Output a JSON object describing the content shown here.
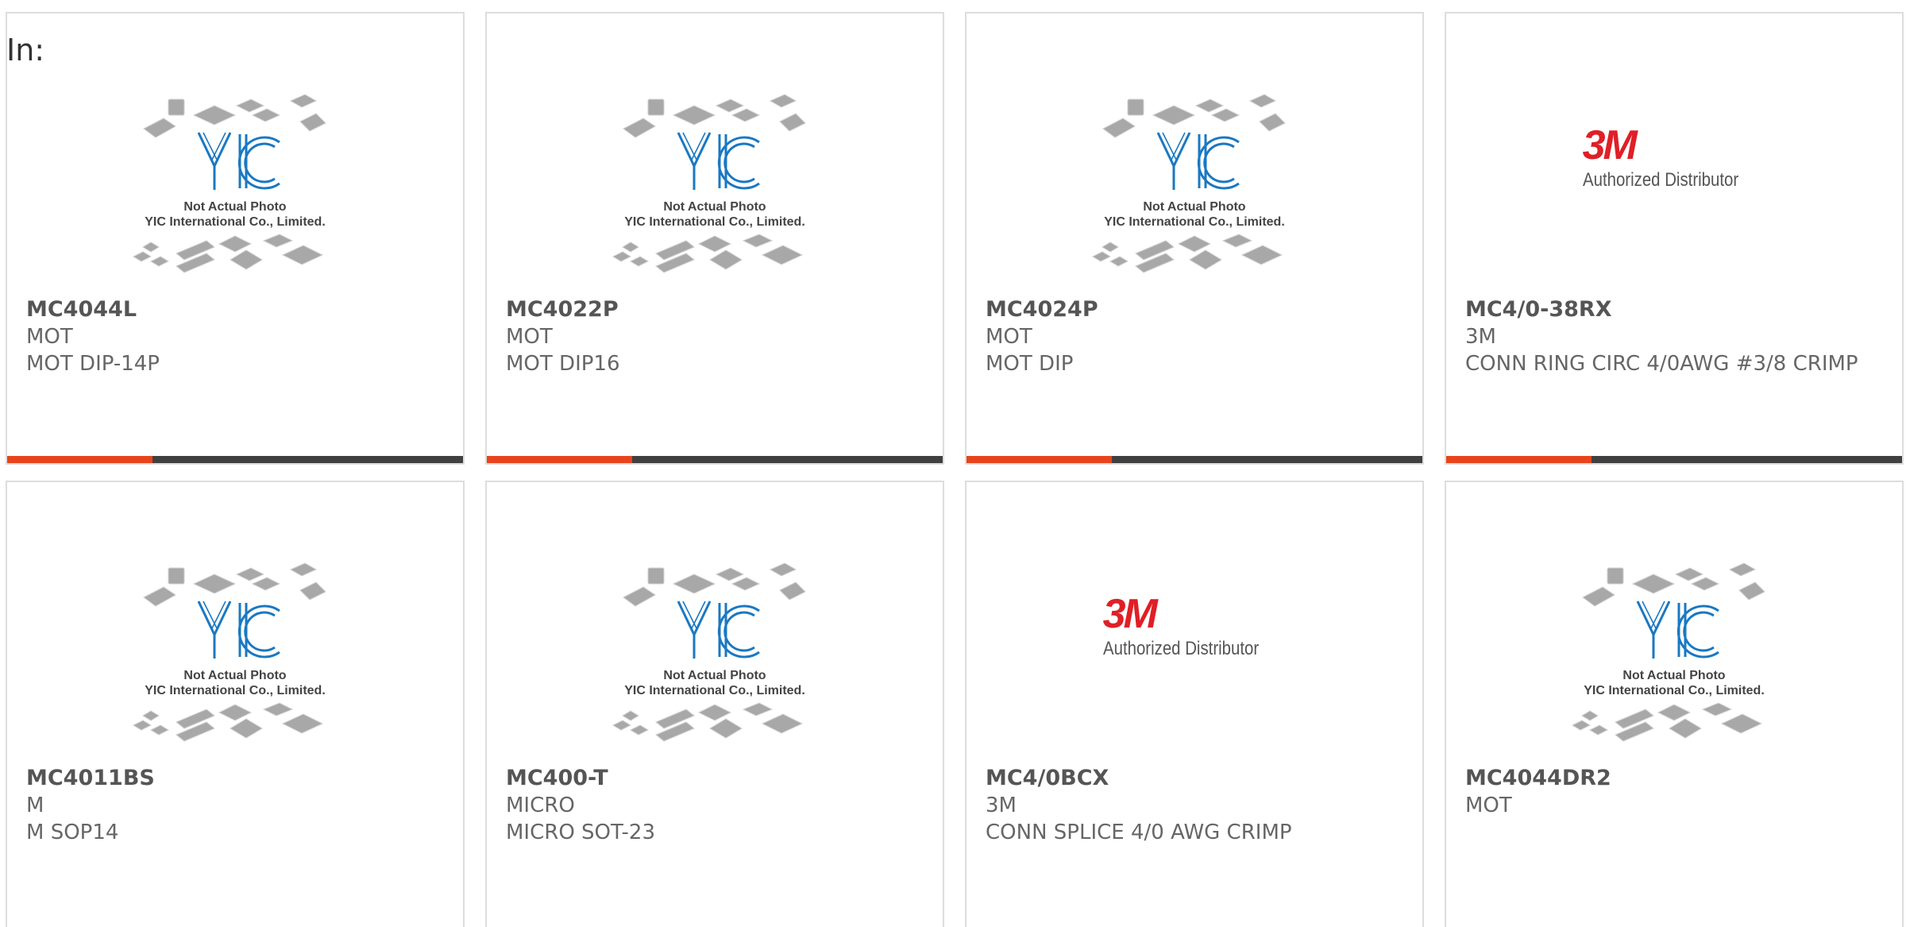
{
  "page": {
    "in_label": "In:"
  },
  "placeholder_image": {
    "line1": "Not Actual Photo",
    "line2": "YIC International Co., Limited."
  },
  "brand_3m": {
    "logo": "3M",
    "tagline": "Authorized Distributor"
  },
  "colors": {
    "accent": "#e8441b",
    "bar_dark": "#404040",
    "logo_blue": "#1a78c2",
    "logo_red": "#e01f26"
  },
  "products": [
    {
      "part": "MC4044L",
      "maker": "MOT",
      "desc": "MOT DIP-14P",
      "image": "yic-placeholder"
    },
    {
      "part": "MC4022P",
      "maker": "MOT",
      "desc": "MOT DIP16",
      "image": "yic-placeholder"
    },
    {
      "part": "MC4024P",
      "maker": "MOT",
      "desc": "MOT DIP",
      "image": "yic-placeholder"
    },
    {
      "part": "MC4/0-38RX",
      "maker": "3M",
      "desc": "CONN RING CIRC 4/0AWG #3/8 CRIMP",
      "image": "3m-authorized"
    },
    {
      "part": "MC4011BS",
      "maker": "M",
      "desc": "M SOP14",
      "image": "yic-placeholder"
    },
    {
      "part": "MC400-T",
      "maker": "MICRO",
      "desc": "MICRO SOT-23",
      "image": "yic-placeholder"
    },
    {
      "part": "MC4/0BCX",
      "maker": "3M",
      "desc": "CONN SPLICE 4/0 AWG CRIMP",
      "image": "3m-authorized"
    },
    {
      "part": "MC4044DR2",
      "maker": "MOT",
      "desc": "",
      "image": "yic-placeholder"
    }
  ]
}
